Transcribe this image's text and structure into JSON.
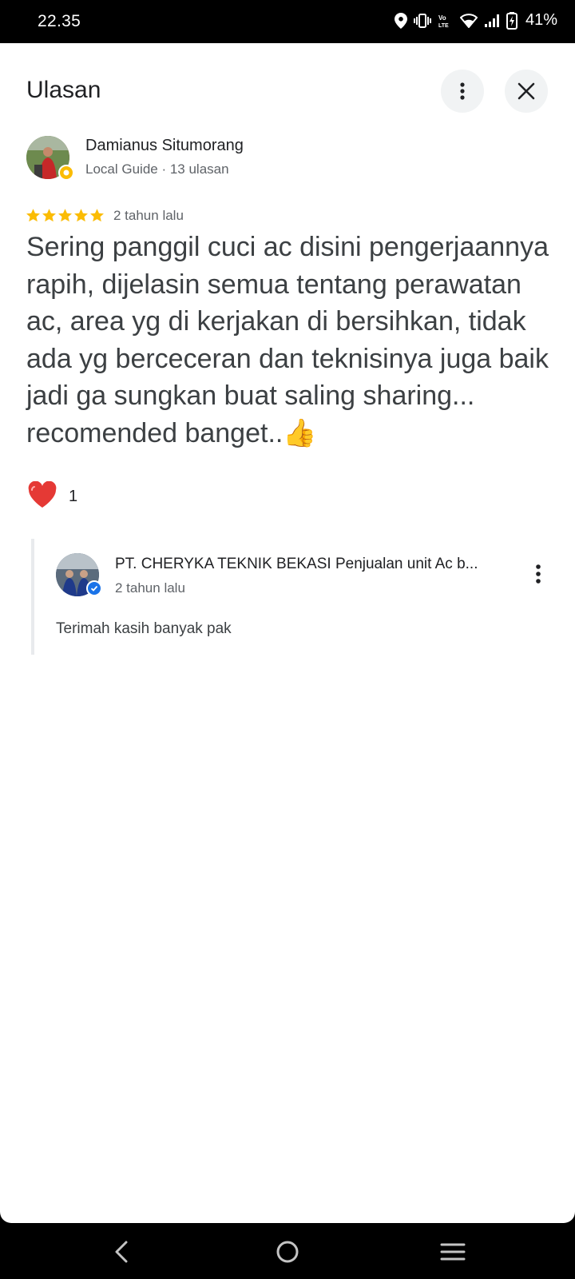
{
  "status_bar": {
    "time": "22.35",
    "battery": "41%",
    "icons": [
      "location-icon",
      "vibrate-icon",
      "volte-icon",
      "wifi-icon",
      "signal-icon",
      "battery-charging-icon"
    ]
  },
  "header": {
    "title": "Ulasan",
    "more_icon": "more-vert-icon",
    "close_icon": "close-icon"
  },
  "review": {
    "author": "Damianus Situmorang",
    "author_meta": "Local Guide · 13 ulasan",
    "rating": 5,
    "date": "2 tahun lalu",
    "text": "Sering panggil cuci ac disini pengerjaannya rapih, dijelasin semua tentang perawatan ac, area yg di kerjakan di bersihkan, tidak ada yg berceceran dan teknisinya juga baik jadi ga sungkan buat saling sharing... recomended banget..👍",
    "like_count": "1"
  },
  "reply": {
    "owner": "PT. CHERYKA TEKNIK BEKASI Penjualan unit Ac b...",
    "date": "2 tahun lalu",
    "text": "Terimah kasih banyak pak"
  },
  "colors": {
    "star": "#fbbc04",
    "heart": "#e53935",
    "verified": "#1a73e8"
  }
}
